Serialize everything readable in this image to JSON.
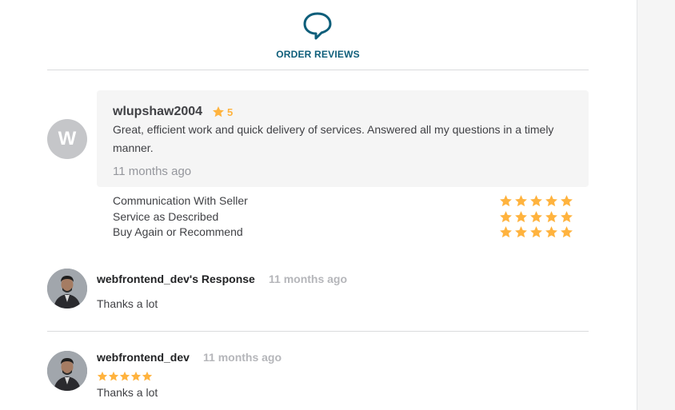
{
  "header": {
    "title": "ORDER REVIEWS",
    "icon": "chat-bubble-icon",
    "accent": "#0e5e7a"
  },
  "review": {
    "avatar_letter": "W",
    "username": "wlupshaw2004",
    "rating": "5",
    "text": "Great, efficient work and quick delivery of services. Answered all my questions in a timely manner.",
    "time": "11 months ago",
    "criteria": [
      {
        "label": "Communication With Seller",
        "stars": 5
      },
      {
        "label": "Service as Described",
        "stars": 5
      },
      {
        "label": "Buy Again or Recommend",
        "stars": 5
      }
    ]
  },
  "response": {
    "name": "webfrontend_dev's Response",
    "time": "11 months ago",
    "text": "Thanks a lot"
  },
  "review2": {
    "name": "webfrontend_dev",
    "time": "11 months ago",
    "stars": 5,
    "text": "Thanks a lot"
  },
  "colors": {
    "star": "#ffb33e",
    "muted": "#95979d"
  }
}
